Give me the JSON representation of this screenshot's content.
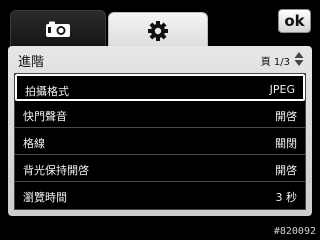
{
  "tabs": [
    {
      "name": "camera",
      "icon": "camera-icon",
      "active": false
    },
    {
      "name": "settings",
      "icon": "gear-icon",
      "active": true
    }
  ],
  "ok_button": {
    "label": "ok"
  },
  "panel": {
    "title": "進階",
    "page_indicator": "頁 1/3"
  },
  "settings": [
    {
      "label": "拍攝格式",
      "value": "JPEG",
      "selected": true
    },
    {
      "label": "快門聲音",
      "value": "開啓",
      "selected": false
    },
    {
      "label": "格線",
      "value": "關閉",
      "selected": false
    },
    {
      "label": "背光保持開啓",
      "value": "開啓",
      "selected": false
    },
    {
      "label": "瀏覽時間",
      "value": "3 秒",
      "selected": false
    }
  ],
  "footer": {
    "code": "#820092"
  }
}
